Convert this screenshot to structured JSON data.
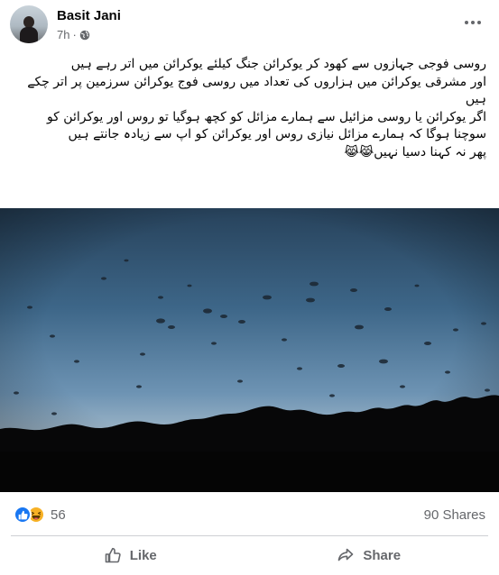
{
  "post": {
    "author": "Basit Jani",
    "time": "7h",
    "separator": "·",
    "privacy_icon": "globe-icon",
    "more_icon": "more-options-icon",
    "text_lines": [
      "روسی فوجی جہازوں سے کھود کر یوکرائن جنگ کیلئے یوکرائن میں اتر رہے ہیں",
      "اور مشرقی یوکرائن میں ہزاروں کی تعداد میں روسی فوج یوکرائن سرزمین پر اتر چکے ہیں",
      "اگر یوکرائن یا روسی مزائیل سے ہمارے مزائل کو کچھ ہوگیا تو روس اور یوکرائن کو سوچنا ہوگا کہ ہمارے مزائل نیازی روس اور یوکرائن کو اپ سے زیادہ جانتے ہیں",
      "پھر نہ کہنا دسیا نہیں😹😹"
    ]
  },
  "engagement": {
    "reactions": [
      "like-reaction-icon",
      "haha-reaction-icon"
    ],
    "reaction_count": "56",
    "shares": "90 Shares"
  },
  "actions": {
    "like_label": "Like",
    "share_label": "Share"
  },
  "colors": {
    "accent": "#1877f2",
    "haha": "#f7b125",
    "secondary_text": "#65676b",
    "divider": "#ced0d4"
  }
}
